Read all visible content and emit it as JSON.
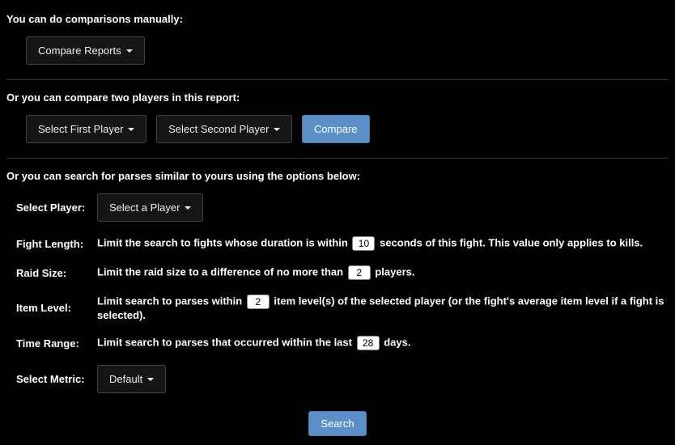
{
  "section1": {
    "text": "You can do comparisons manually:",
    "compare_reports_label": "Compare Reports"
  },
  "section2": {
    "text": "Or you can compare two players in this report:",
    "first_player_label": "Select First Player",
    "second_player_label": "Select Second Player",
    "compare_label": "Compare"
  },
  "section3": {
    "text": "Or you can search for parses similar to yours using the options below:",
    "select_player": {
      "label": "Select Player:",
      "button": "Select a Player"
    },
    "fight_length": {
      "label": "Fight Length:",
      "pre": "Limit the search to fights whose duration is within ",
      "value": "10",
      "post": " seconds of this fight. This value only applies to kills."
    },
    "raid_size": {
      "label": "Raid Size:",
      "pre": "Limit the raid size to a difference of no more than ",
      "value": "2",
      "post": " players."
    },
    "item_level": {
      "label": "Item Level:",
      "pre": "Limit search to parses within ",
      "value": "2",
      "post": " item level(s) of the selected player (or the fight's average item level if a fight is selected)."
    },
    "time_range": {
      "label": "Time Range:",
      "pre": "Limit search to parses that occurred within the last ",
      "value": "28",
      "post": " days."
    },
    "select_metric": {
      "label": "Select Metric:",
      "button": "Default"
    },
    "search_label": "Search"
  }
}
